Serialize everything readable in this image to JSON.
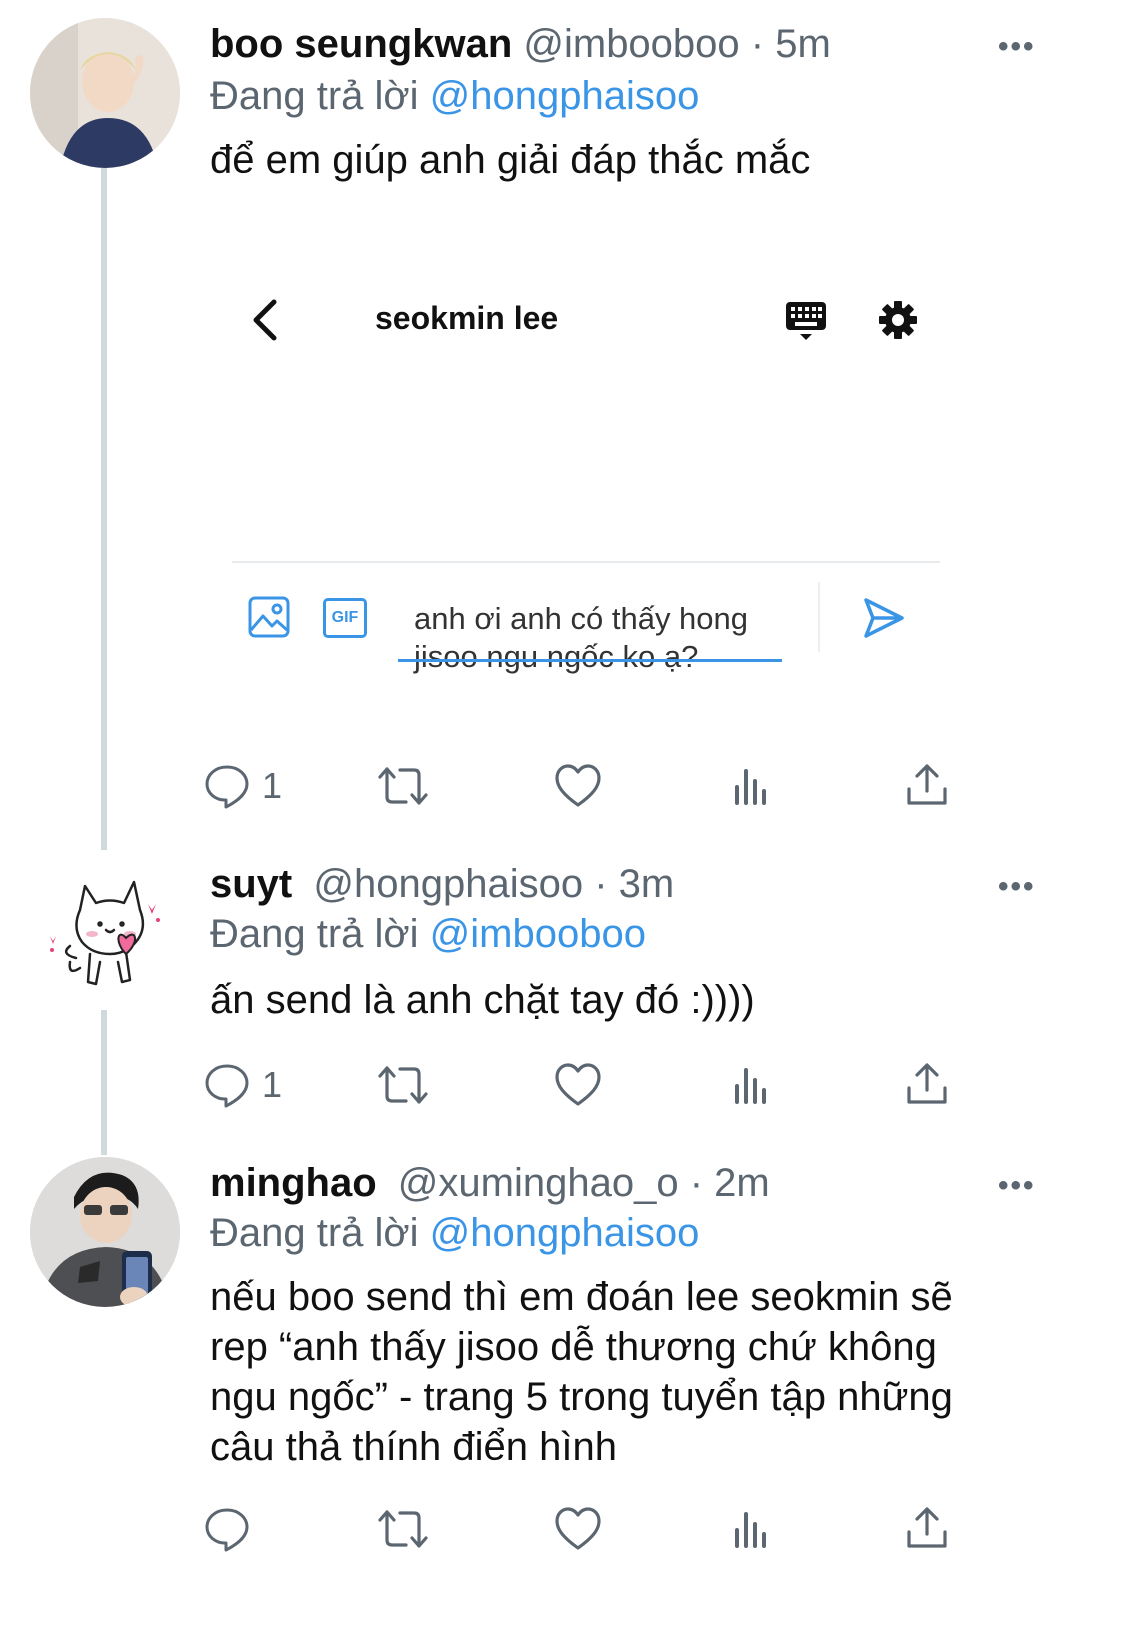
{
  "tweets": [
    {
      "name": "boo seungkwan",
      "handle": "@imbooboo · 5m",
      "reply_prefix": "Đang trả lời",
      "reply_to": "@hongphaisoo",
      "text": "để em giúp anh giải đáp thắc mắc",
      "reply_count": "1"
    },
    {
      "name": "suyt",
      "handle": "@hongphaisoo · 3m",
      "reply_prefix": "Đang trả lời",
      "reply_to": "@imbooboo",
      "text": "ấn send là anh chặt tay đó :))))",
      "reply_count": "1"
    },
    {
      "name": "minghao",
      "handle": "@xuminghao_o · 2m",
      "reply_prefix": "Đang trả lời",
      "reply_to": "@hongphaisoo",
      "text_lines": [
        "nếu boo send thì em đoán lee seokmin sẽ",
        "rep “anh thấy jisoo dễ thương chứ không",
        "ngu ngốc” - trang 5 trong tuyển tập những",
        "câu thả thính điển hình"
      ],
      "reply_count": ""
    }
  ],
  "embedded_dm": {
    "title": "seokmin lee",
    "message_lines": [
      "anh ơi anh có thấy hong",
      "jisoo ngu ngốc ko ạ?"
    ],
    "gif_label": "GIF"
  },
  "more_label": "•••",
  "colors": {
    "accent": "#3a95e6",
    "muted": "#5b6670",
    "thread": "#cfd9de"
  }
}
